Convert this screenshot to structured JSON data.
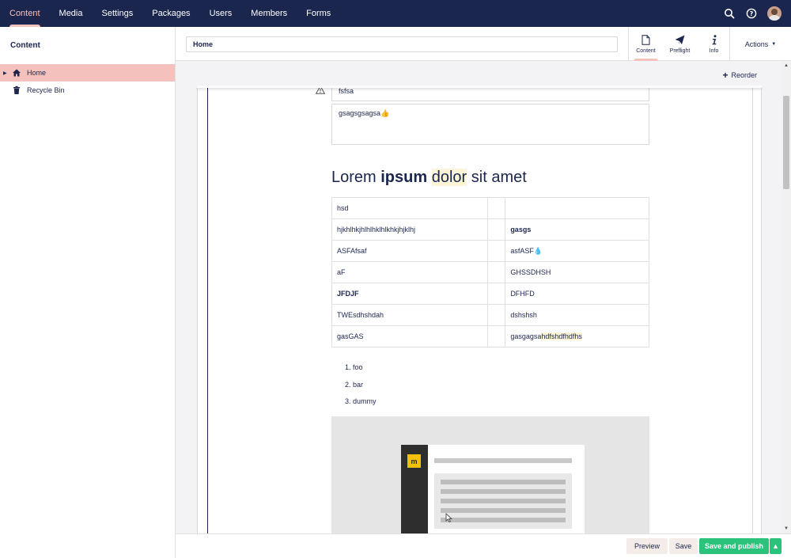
{
  "topnav": {
    "items": [
      "Content",
      "Media",
      "Settings",
      "Packages",
      "Users",
      "Members",
      "Forms"
    ],
    "active": "Content"
  },
  "sidebar": {
    "title": "Content",
    "tree": [
      {
        "label": "Home",
        "icon": "home-icon",
        "selected": true
      },
      {
        "label": "Recycle Bin",
        "icon": "trash-icon",
        "selected": false
      }
    ]
  },
  "editor": {
    "name_value": "Home",
    "tabs": [
      {
        "label": "Content",
        "icon": "document-icon"
      },
      {
        "label": "Preflight",
        "icon": "paper-plane-icon"
      },
      {
        "label": "Info",
        "icon": "info-icon"
      }
    ],
    "actions_label": "Actions"
  },
  "main": {
    "reorder_label": "Reorder",
    "field_fsfsa": "fsfsa",
    "field_text": "gsagsgsagsa",
    "heading": {
      "part1": "Lorem ",
      "bold": "ipsum",
      "space": " ",
      "highlight": "dolor",
      "part2": " sit amet"
    },
    "table": [
      [
        "hsd",
        "",
        ""
      ],
      [
        "hjkhlhkjhlhlhklhlkhkjhjklhj",
        "",
        "gasgs"
      ],
      [
        "ASFAfsaf",
        "",
        "asfASF"
      ],
      [
        "aF",
        "",
        "GHSSDHSH"
      ],
      [
        "JFDJF",
        "",
        "DFHFD"
      ],
      [
        "TWEsdhshdah",
        "",
        "dshshsh"
      ],
      [
        "gasGAS",
        "",
        "gasgagsa"
      ]
    ],
    "table_highlight_suffix": "hdfshdfhdfhs",
    "list": [
      "foo",
      "bar",
      "dummy"
    ],
    "mock_logo": "m"
  },
  "footer": {
    "preview": "Preview",
    "save": "Save",
    "save_publish": "Save and publish"
  },
  "colors": {
    "navy": "#1b264f",
    "pink": "#f5c1bc",
    "green": "#2bc37c"
  }
}
